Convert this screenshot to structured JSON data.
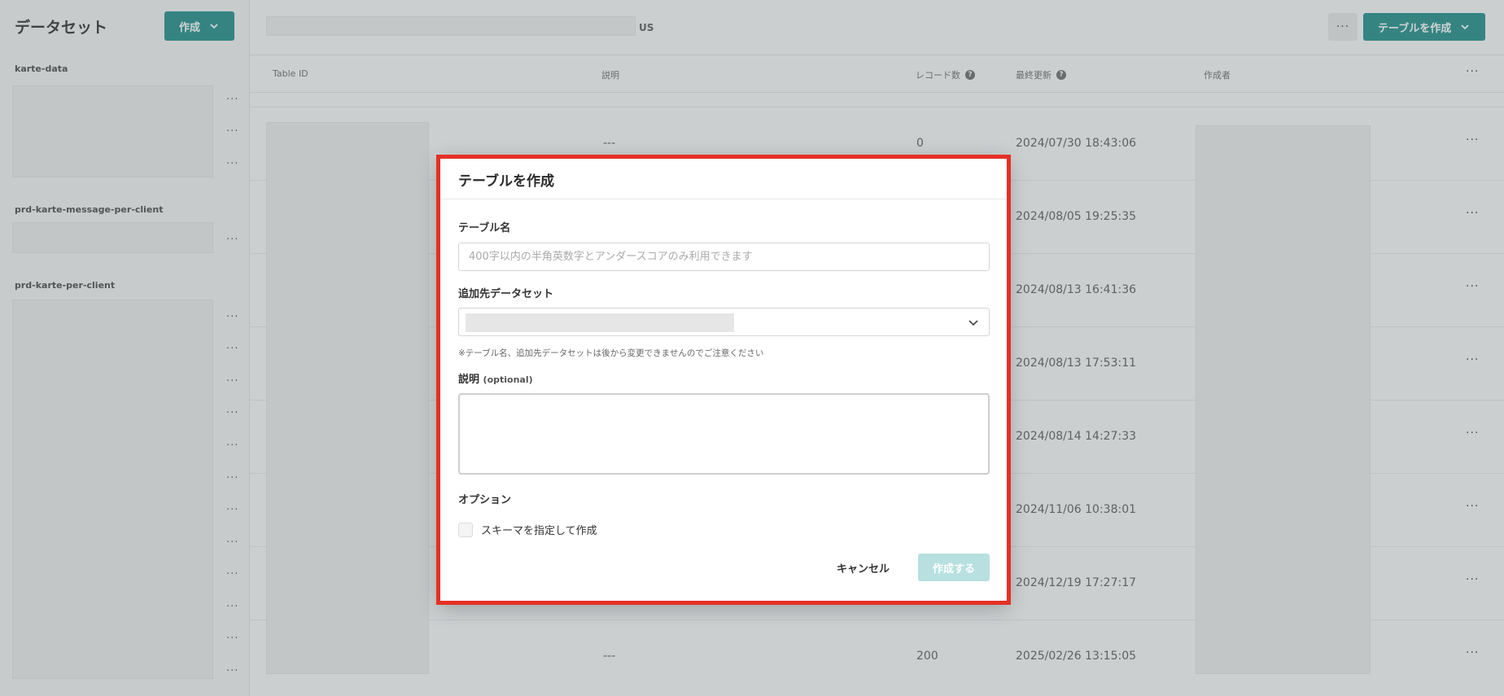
{
  "sidebar": {
    "title": "データセット",
    "create_label": "作成",
    "sections": [
      {
        "label": "karte-data"
      },
      {
        "label": "prd-karte-message-per-client"
      },
      {
        "label": "prd-karte-per-client"
      }
    ],
    "dots": "···"
  },
  "header": {
    "region": "US",
    "more_label": "···",
    "create_table_label": "テーブルを作成"
  },
  "table": {
    "columns": {
      "table_id": "Table ID",
      "description": "説明",
      "record_count": "レコード数",
      "last_updated": "最終更新",
      "author": "作成者"
    },
    "help_glyph": "?",
    "rows": [
      {
        "description": "---",
        "record_count": "0",
        "last_updated": "2024/07/30 18:43:06"
      },
      {
        "description": "",
        "record_count": "",
        "last_updated": "2024/08/05 19:25:35"
      },
      {
        "description": "",
        "record_count": "",
        "last_updated": "2024/08/13 16:41:36"
      },
      {
        "description": "",
        "record_count": "",
        "last_updated": "2024/08/13 17:53:11"
      },
      {
        "description": "",
        "record_count": "",
        "last_updated": "2024/08/14 14:27:33"
      },
      {
        "description": "",
        "record_count": "",
        "last_updated": "2024/11/06 10:38:01"
      },
      {
        "description": "",
        "record_count": "",
        "last_updated": "2024/12/19 17:27:17"
      },
      {
        "description": "---",
        "record_count": "200",
        "last_updated": "2025/02/26 13:15:05"
      }
    ]
  },
  "dialog": {
    "title": "テーブルを作成",
    "table_name_label": "テーブル名",
    "table_name_placeholder": "400字以内の半角英数字とアンダースコアのみ利用できます",
    "dataset_label": "追加先データセット",
    "note": "※テーブル名、追加先データセットは後から変更できませんのでご注意ください",
    "description_label": "説明",
    "description_optional": "(optional)",
    "options_label": "オプション",
    "schema_checkbox_label": "スキーマを指定して作成",
    "cancel_label": "キャンセル",
    "submit_label": "作成する"
  },
  "colors": {
    "accent": "#1a8a85",
    "accent_disabled": "#b8e0e0",
    "highlight": "#e53025"
  }
}
